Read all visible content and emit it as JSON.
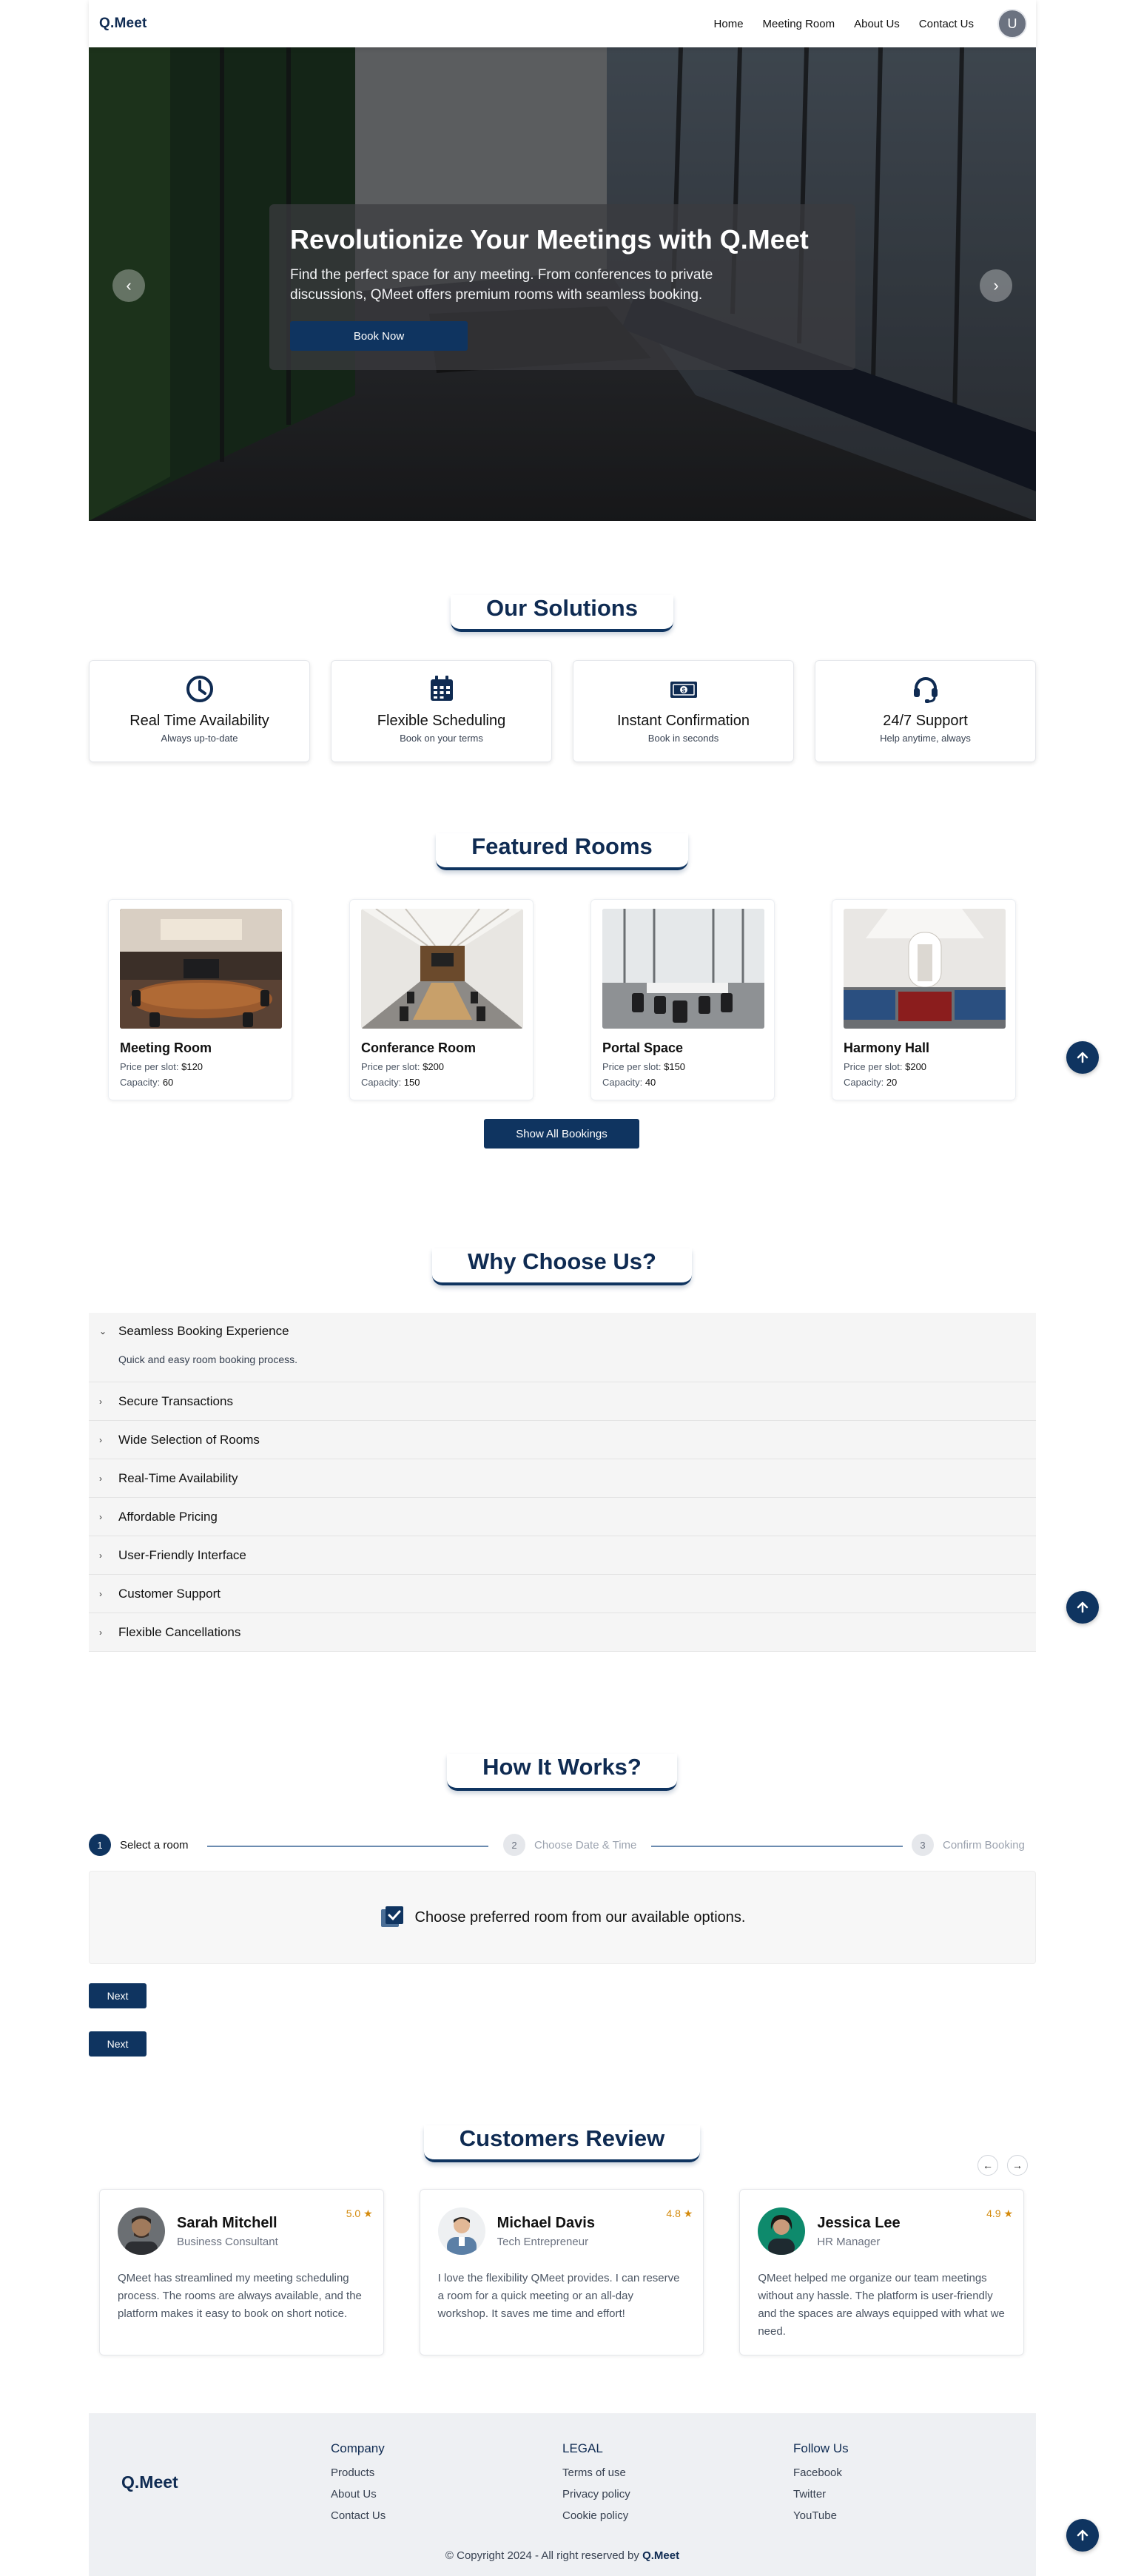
{
  "header": {
    "logo": "Q.Meet",
    "nav": [
      "Home",
      "Meeting Room",
      "About Us",
      "Contact Us"
    ],
    "avatar_initial": "U"
  },
  "hero": {
    "title": "Revolutionize Your Meetings with Q.Meet",
    "subtitle": "Find the perfect space for any meeting. From conferences to private discussions, QMeet offers premium rooms with seamless booking.",
    "cta": "Book Now",
    "prev_icon": "chevron-left-icon",
    "next_icon": "chevron-right-icon"
  },
  "solutions": {
    "title": "Our Solutions",
    "items": [
      {
        "icon": "clock-icon",
        "title": "Real Time Availability",
        "sub": "Always up-to-date"
      },
      {
        "icon": "calendar-icon",
        "title": "Flexible Scheduling",
        "sub": "Book on your terms"
      },
      {
        "icon": "money-icon",
        "title": "Instant Confirmation",
        "sub": "Book in seconds"
      },
      {
        "icon": "headset-icon",
        "title": "24/7 Support",
        "sub": "Help anytime, always"
      }
    ]
  },
  "rooms": {
    "title": "Featured Rooms",
    "price_label": "Price per slot:",
    "capacity_label": "Capacity:",
    "button": "Show All Bookings",
    "items": [
      {
        "name": "Meeting Room",
        "price": "$120",
        "capacity": "60"
      },
      {
        "name": "Conferance Room",
        "price": "$200",
        "capacity": "150"
      },
      {
        "name": "Portal Space",
        "price": "$150",
        "capacity": "40"
      },
      {
        "name": "Harmony Hall",
        "price": "$200",
        "capacity": "20"
      }
    ]
  },
  "why": {
    "title": "Why Choose Us?",
    "items": [
      {
        "label": "Seamless Booking Experience",
        "body": "Quick and easy room booking process."
      },
      {
        "label": "Secure Transactions"
      },
      {
        "label": "Wide Selection of Rooms"
      },
      {
        "label": "Real-Time Availability"
      },
      {
        "label": "Affordable Pricing"
      },
      {
        "label": "User-Friendly Interface"
      },
      {
        "label": "Customer Support"
      },
      {
        "label": "Flexible Cancellations"
      }
    ]
  },
  "how": {
    "title": "How It Works?",
    "steps": [
      {
        "num": "1",
        "label": "Select a room"
      },
      {
        "num": "2",
        "label": "Choose Date & Time"
      },
      {
        "num": "3",
        "label": "Confirm Booking"
      }
    ],
    "panel_text": "Choose preferred room from our available options.",
    "next": "Next",
    "next2": "Next"
  },
  "reviews": {
    "title": "Customers Review",
    "items": [
      {
        "name": "Sarah Mitchell",
        "role": "Business Consultant",
        "rating": "5.0",
        "text": "QMeet has streamlined my meeting scheduling process. The rooms are always available, and the platform makes it easy to book on short notice."
      },
      {
        "name": "Michael Davis",
        "role": "Tech Entrepreneur",
        "rating": "4.8",
        "text": "I love the flexibility QMeet provides. I can reserve a room for a quick meeting or an all-day workshop. It saves me time and effort!"
      },
      {
        "name": "Jessica Lee",
        "role": "HR Manager",
        "rating": "4.9",
        "text": "QMeet helped me organize our team meetings without any hassle. The platform is user-friendly and the spaces are always equipped with what we need."
      }
    ]
  },
  "footer": {
    "logo": "Q.Meet",
    "company": {
      "title": "Company",
      "links": [
        "Products",
        "About Us",
        "Contact Us"
      ]
    },
    "legal": {
      "title": "LEGAL",
      "links": [
        "Terms of use",
        "Privacy policy",
        "Cookie policy"
      ]
    },
    "follow": {
      "title": "Follow Us",
      "links": [
        "Facebook",
        "Twitter",
        "YouTube"
      ]
    },
    "copyright": "© Copyright 2024 - All right reserved by",
    "brand": "Q.Meet"
  },
  "colors": {
    "primary": "#0f3460",
    "heading": "#0f2b52",
    "star": "#d48a0c"
  }
}
